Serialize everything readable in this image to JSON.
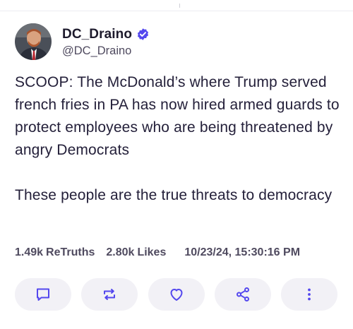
{
  "post": {
    "author": {
      "display_name": "DC_Draino",
      "handle": "@DC_Draino",
      "verified": true,
      "avatar": "avatar-photo"
    },
    "body_lines": [
      "SCOOP: The McDonald’s where Trump served french fries in PA has now hired armed guards to protect employees who are being threatened by angry Democrats",
      "These people are the true threats to democracy"
    ],
    "stats": {
      "retruths_count": "1.49k",
      "retruths_label": "ReTruths",
      "likes_count": "2.80k",
      "likes_label": "Likes",
      "timestamp": "10/23/24, 15:30:16 PM"
    },
    "actions": [
      {
        "name": "reply-button",
        "icon": "comment-icon"
      },
      {
        "name": "retruth-button",
        "icon": "repost-icon"
      },
      {
        "name": "like-button",
        "icon": "heart-icon"
      },
      {
        "name": "share-button",
        "icon": "share-icon"
      },
      {
        "name": "more-button",
        "icon": "more-vertical-icon"
      }
    ]
  },
  "colors": {
    "verified_badge": "#5448ee",
    "text_primary": "#1d1a2c",
    "text_secondary": "#4f4a5f",
    "button_bg": "#f2f1f6",
    "icon": "#5448ee"
  }
}
